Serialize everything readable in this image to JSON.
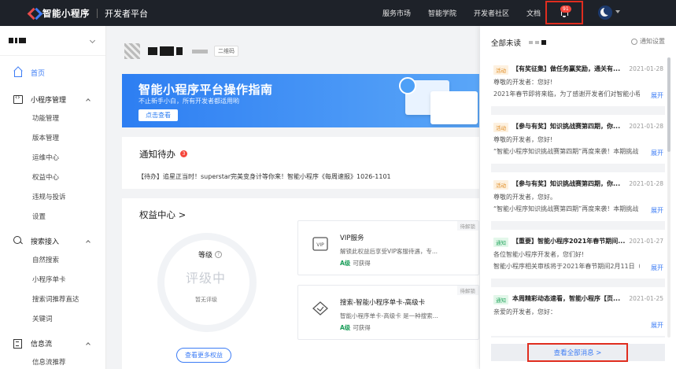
{
  "brand": {
    "name": "智能小程序",
    "platform": "开发者平台"
  },
  "nav": {
    "items": [
      "服务市场",
      "智能学院",
      "开发者社区",
      "文档"
    ]
  },
  "header": {
    "notification_count": "91"
  },
  "sidebar": {
    "home": "首页",
    "groups": [
      {
        "label": "小程序管理",
        "items": [
          "功能管理",
          "版本管理",
          "运维中心",
          "权益中心",
          "违规与投诉",
          "设置"
        ]
      },
      {
        "label": "搜索接入",
        "items": [
          "自然搜索",
          "小程序单卡",
          "搜索词推荐直达",
          "关键词"
        ]
      },
      {
        "label": "信息流",
        "items": [
          "信息流推荐"
        ]
      }
    ]
  },
  "app": {
    "qr_label": "二维码"
  },
  "banner": {
    "title": "智能小程序平台操作指南",
    "subtitle": "不止新手小白，所有开发者都适用哟",
    "button": "点击查看"
  },
  "notice": {
    "title": "通知待办",
    "count": "3",
    "text": "【待办】追星正当时！superstar完美变身计等你来！智能小程序《每周速报》1026-1101"
  },
  "rights": {
    "title": "权益中心 >",
    "level_label": "等级",
    "level_value": "评级中",
    "level_sub": "暂无评级",
    "button": "查看更多权益",
    "cards": [
      {
        "tag": "待解锁",
        "icon": "vip-icon",
        "title": "VIP服务",
        "desc": "解锁此权益后享受VIP客服待遇，专...",
        "level": "A级",
        "status": "可获得"
      },
      {
        "tag": "待解锁",
        "icon": "diamond-icon",
        "title": "搜索-智能小程序单卡-高级卡",
        "desc": "智能小程序单卡-高级卡 是一种搜索...",
        "level": "A级",
        "status": "可获得"
      }
    ]
  },
  "notifications": {
    "header": "全部未读",
    "settings": "通知设置",
    "view_all": "查看全部消息 >",
    "items": [
      {
        "tag": "活动",
        "type": "act",
        "title": "【有奖征集】做任务赢奖励，通关有...",
        "time": "2021-01-28",
        "line1": "尊敬的开发者：您好!",
        "line2": "2021年春节即将来临，为了感谢开发者们对智能小程序",
        "more": "展开"
      },
      {
        "tag": "活动",
        "type": "act",
        "title": "【参与有奖】知识挑战赛第四期，你...",
        "time": "2021-01-28",
        "line1": "尊敬的开发者，您好!",
        "line2": "“智能小程序知识挑战赛第四期”再度来袭！本期挑战",
        "more": "展开"
      },
      {
        "tag": "活动",
        "type": "act",
        "title": "【参与有奖】知识挑战赛第四期，你...",
        "time": "2021-01-28",
        "line1": "尊敬的开发者，您好。",
        "line2": "“智能小程序知识挑战赛第四期”再度来袭！本期挑战",
        "more": "展开"
      },
      {
        "tag": "通知",
        "type": "ntf",
        "title": "【重要】智能小程序2021年春节期间...",
        "time": "2021-01-27",
        "line1": "各位智能小程序开发者，您们好!",
        "line2": "智能小程序相关审核将于2021年春节期间2月11日（",
        "more": "展开"
      },
      {
        "tag": "通知",
        "type": "ntf",
        "title": "本周精彩动态速看，智能小程序【页...",
        "time": "2021-01-25",
        "line1": "亲爱的开发者，您好：",
        "line2": "",
        "more": "展开"
      }
    ]
  }
}
